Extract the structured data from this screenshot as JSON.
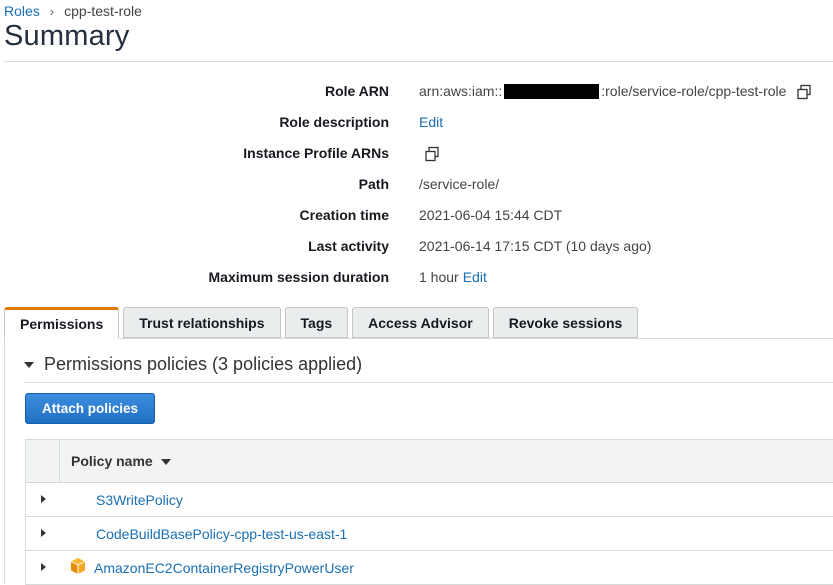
{
  "breadcrumb": {
    "parent": "Roles",
    "separator": "›",
    "current": "cpp-test-role"
  },
  "page": {
    "title": "Summary"
  },
  "summary": {
    "role_arn": {
      "label": "Role ARN",
      "prefix": "arn:aws:iam::",
      "suffix": ":role/service-role/cpp-test-role"
    },
    "role_description": {
      "label": "Role description",
      "action": "Edit"
    },
    "instance_profile": {
      "label": "Instance Profile ARNs"
    },
    "path": {
      "label": "Path",
      "value": "/service-role/"
    },
    "creation_time": {
      "label": "Creation time",
      "value": "2021-06-04 15:44 CDT"
    },
    "last_activity": {
      "label": "Last activity",
      "value": "2021-06-14 17:15 CDT (10 days ago)"
    },
    "max_session": {
      "label": "Maximum session duration",
      "value": "1 hour",
      "action": "Edit"
    }
  },
  "tabs": [
    {
      "label": "Permissions",
      "active": true
    },
    {
      "label": "Trust relationships",
      "active": false
    },
    {
      "label": "Tags",
      "active": false
    },
    {
      "label": "Access Advisor",
      "active": false
    },
    {
      "label": "Revoke sessions",
      "active": false
    }
  ],
  "permissions": {
    "section_title": "Permissions policies (3 policies applied)",
    "attach_button": "Attach policies",
    "table": {
      "column": "Policy name",
      "rows": [
        {
          "name": "S3WritePolicy",
          "icon": "none"
        },
        {
          "name": "CodeBuildBasePolicy-cpp-test-us-east-1",
          "icon": "none"
        },
        {
          "name": "AmazonEC2ContainerRegistryPowerUser",
          "icon": "aws-managed-policy-cube-icon"
        }
      ]
    }
  },
  "colors": {
    "link": "#1a6fb3",
    "tab_active_accent": "#e07b00",
    "primary_button": "#1f6fc2",
    "managed_policy_icon": "#f5a623"
  }
}
